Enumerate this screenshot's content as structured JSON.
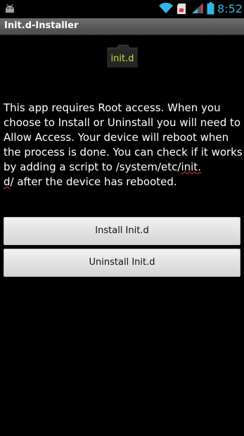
{
  "statusbar": {
    "time": "8:52",
    "icons": [
      "android-icon",
      "wifi-icon",
      "sd-card-icon",
      "signal-icon",
      "battery-icon"
    ],
    "accent_color": "#33b5e5"
  },
  "app": {
    "title": "Init.d-Installer"
  },
  "logo": {
    "label": "init.d",
    "color": "#2b2b2b"
  },
  "content": {
    "description_before": "This app requires Root access. When you choose to Install or Uninstall you will need to Allow Access. Your device will reboot when the process is done. You can check if it works by adding a script to /system/etc/",
    "description_spell_1": "init.",
    "description_newline": "\n",
    "description_spell_2": "d",
    "description_after": "/ after the device has rebooted."
  },
  "buttons": {
    "install": "Install Init.d",
    "uninstall": "Uninstall Init.d"
  }
}
